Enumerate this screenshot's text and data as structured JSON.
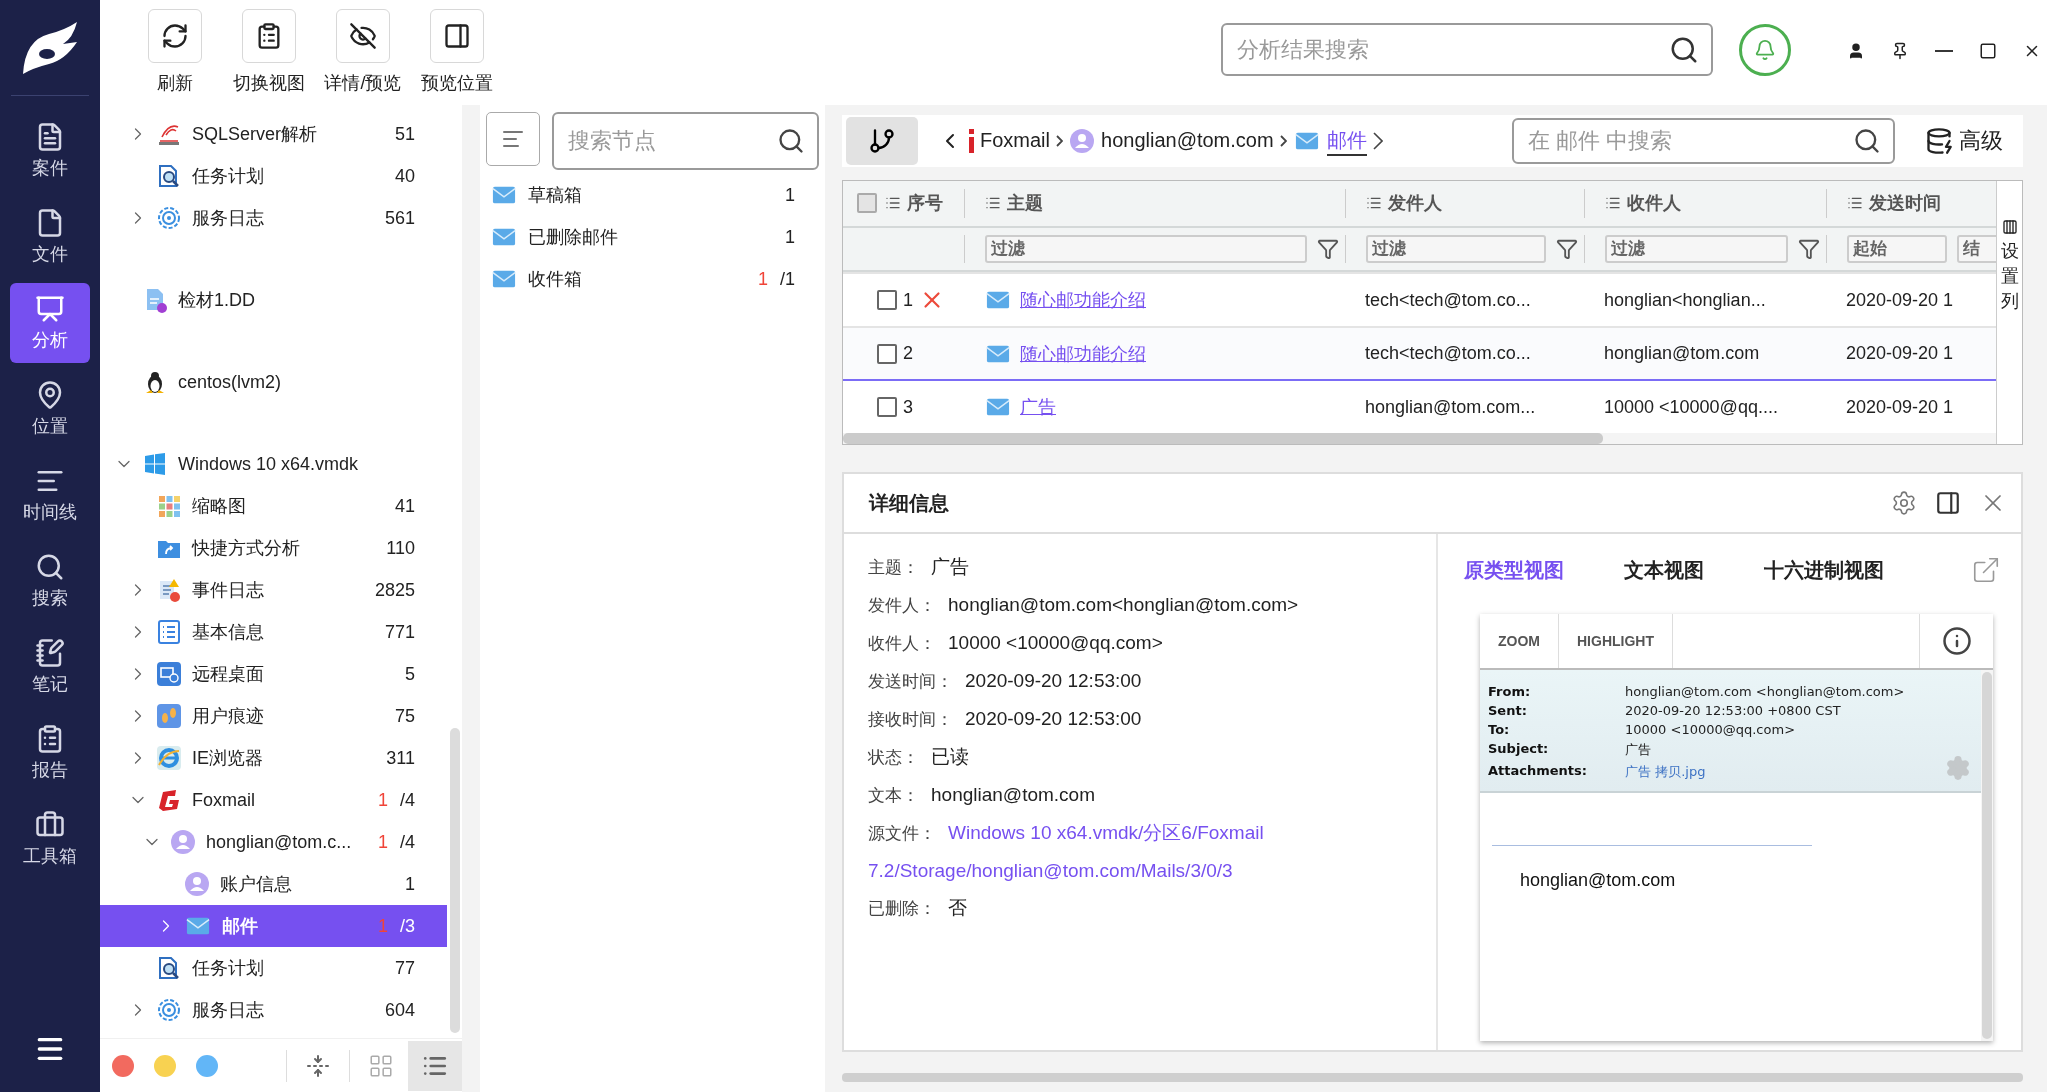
{
  "sidebar": {
    "items": [
      {
        "kind": "case",
        "label": "案件",
        "selected": false
      },
      {
        "kind": "file",
        "label": "文件",
        "selected": false
      },
      {
        "kind": "analysis",
        "label": "分析",
        "selected": true
      },
      {
        "kind": "location",
        "label": "位置",
        "selected": false
      },
      {
        "kind": "timeline",
        "label": "时间线",
        "selected": false
      },
      {
        "kind": "search",
        "label": "搜索",
        "selected": false
      },
      {
        "kind": "notes",
        "label": "笔记",
        "selected": false
      },
      {
        "kind": "report",
        "label": "报告",
        "selected": false
      },
      {
        "kind": "toolbox",
        "label": "工具箱",
        "selected": false
      }
    ]
  },
  "toolbar": {
    "buttons": [
      {
        "kind": "refresh",
        "label": "刷新"
      },
      {
        "kind": "switch",
        "label": "切换视图"
      },
      {
        "kind": "toggle",
        "label": "详情/预览"
      },
      {
        "kind": "position",
        "label": "预览位置"
      }
    ],
    "search": {
      "placeholder": "分析结果搜索"
    }
  },
  "tree": {
    "items": [
      {
        "kind": "sqlserver",
        "label": "SQLServer解析",
        "count": "51",
        "expanded": false,
        "selected": false
      },
      {
        "kind": "task",
        "label": "任务计划",
        "count": "40",
        "selected": false
      },
      {
        "kind": "service",
        "label": "服务日志",
        "count": "561",
        "expanded": false,
        "selected": false
      },
      {
        "kind": "disk",
        "label": "检材1.DD",
        "selected": false
      },
      {
        "kind": "linux",
        "label": "centos(lvm2)",
        "selected": false
      },
      {
        "kind": "windows",
        "label": "Windows 10 x64.vmdk",
        "expanded": true,
        "selected": false,
        "children": [
          {
            "kind": "thumbnails",
            "label": "缩略图",
            "count": "41",
            "selected": false
          },
          {
            "kind": "shortcut",
            "label": "快捷方式分析",
            "count": "110",
            "selected": false
          },
          {
            "kind": "eventlog",
            "label": "事件日志",
            "count": "2825",
            "expanded": false,
            "selected": false
          },
          {
            "kind": "basicinfo",
            "label": "基本信息",
            "count": "771",
            "expanded": false,
            "selected": false
          },
          {
            "kind": "remote",
            "label": "远程桌面",
            "count": "5",
            "expanded": false,
            "selected": false
          },
          {
            "kind": "footprint",
            "label": "用户痕迹",
            "count": "75",
            "expanded": false,
            "selected": false
          },
          {
            "kind": "ie",
            "label": "IE浏览器",
            "count": "311",
            "expanded": false,
            "selected": false
          },
          {
            "kind": "foxmail",
            "label": "Foxmail",
            "unread": "1",
            "count": "/4",
            "expanded": true,
            "selected": false,
            "children": [
              {
                "kind": "account",
                "label": "honglian@tom.c...",
                "unread": "1",
                "count": "/4",
                "expanded": true,
                "selected": false,
                "children": [
                  {
                    "kind": "account",
                    "label": "账户信息",
                    "count": "1",
                    "selected": false
                  },
                  {
                    "kind": "mail",
                    "label": "邮件",
                    "unread": "1",
                    "count": "/3",
                    "expanded": false,
                    "selected": true
                  }
                ]
              }
            ]
          },
          {
            "kind": "task",
            "label": "任务计划",
            "count": "77",
            "selected": false
          },
          {
            "kind": "service",
            "label": "服务日志",
            "count": "604",
            "expanded": false,
            "selected": false
          }
        ]
      }
    ],
    "color_tags": [
      {
        "color": "#f26a5f"
      },
      {
        "color": "#f8d251"
      },
      {
        "color": "#62b6f7"
      }
    ],
    "view_modes": [
      {
        "kind": "grid",
        "selected": false
      },
      {
        "kind": "list",
        "selected": true
      }
    ]
  },
  "folders": {
    "search": {
      "placeholder": "搜索节点"
    },
    "items": [
      {
        "label": "草稿箱",
        "count": "1"
      },
      {
        "label": "已删除邮件",
        "count": "1"
      },
      {
        "label": "收件箱",
        "unread": "1",
        "count": "/1"
      }
    ]
  },
  "breadcrumb": {
    "items": [
      {
        "kind": "foxmail",
        "label": "Foxmail",
        "selected": false
      },
      {
        "kind": "account",
        "label": "honglian@tom.com",
        "selected": false
      },
      {
        "kind": "mail",
        "label": "邮件",
        "selected": true
      }
    ],
    "search": {
      "placeholder": "在 邮件 中搜索"
    },
    "advanced": "高级"
  },
  "table": {
    "columns": [
      {
        "label": "序号"
      },
      {
        "label": "主题",
        "filters": [
          {
            "placeholder": "过滤"
          }
        ]
      },
      {
        "label": "发件人",
        "filters": [
          {
            "placeholder": "过滤"
          }
        ]
      },
      {
        "label": "收件人",
        "filters": [
          {
            "placeholder": "过滤"
          }
        ]
      },
      {
        "label": "发送时间",
        "filters": [
          {
            "placeholder": "起始"
          },
          {
            "placeholder": "结"
          }
        ]
      }
    ],
    "select_all": {
      "checked": false
    },
    "rows": [
      {
        "checked": false,
        "selected": false,
        "deleted": true,
        "index": "1",
        "subject": "随心邮功能介绍",
        "sender": "tech<tech@tom.co...",
        "recipient": "honglian<honglian...",
        "sent_time": "2020-09-20 1"
      },
      {
        "checked": false,
        "selected": false,
        "deleted": false,
        "index": "2",
        "subject": "随心邮功能介绍",
        "sender": "tech<tech@tom.co...",
        "recipient": "honglian@tom.com",
        "sent_time": "2020-09-20 1"
      },
      {
        "checked": false,
        "selected": true,
        "deleted": false,
        "index": "3",
        "subject": "广告",
        "sender": "honglian@tom.com...",
        "recipient": "10000 <10000@qq....",
        "sent_time": "2020-09-20 1"
      }
    ],
    "settings": "设置列"
  },
  "details": {
    "title": "详细信息",
    "fields": [
      {
        "label": "主题：",
        "value": "广告"
      },
      {
        "label": "发件人：",
        "value": "honglian@tom.com<honglian@tom.com>"
      },
      {
        "label": "收件人：",
        "value": "10000 <10000@qq.com>"
      },
      {
        "label": "发送时间：",
        "value": "2020-09-20 12:53:00"
      },
      {
        "label": "接收时间：",
        "value": "2020-09-20 12:53:00"
      },
      {
        "label": "状态：",
        "value": "已读"
      },
      {
        "label": "文本：",
        "value": "honglian@tom.com"
      },
      {
        "label": "源文件：",
        "value": "Windows 10 x64.vmdk/分区6/Foxmail 7.2/Storage/honglian@tom.com/Mails/3/0/3",
        "kind": "link"
      },
      {
        "label": "已删除：",
        "value": "否"
      }
    ]
  },
  "preview": {
    "tabs": [
      {
        "label": "原类型视图",
        "selected": true
      },
      {
        "label": "文本视图",
        "selected": false
      },
      {
        "label": "十六进制视图",
        "selected": false
      }
    ],
    "toolbar": [
      "ZOOM",
      "HIGHLIGHT"
    ],
    "headers": [
      {
        "label": "From:",
        "value": "honglian@tom.com <honglian@tom.com>"
      },
      {
        "label": "Sent:",
        "value": "2020-09-20 12:53:00 +0800 CST"
      },
      {
        "label": "To:",
        "value": "10000 <10000@qq.com>"
      },
      {
        "label": "Subject:",
        "value": "广告"
      },
      {
        "label": "Attachments:",
        "value": "广告 拷贝.jpg",
        "kind": "link"
      }
    ],
    "body": "honglian@tom.com"
  }
}
